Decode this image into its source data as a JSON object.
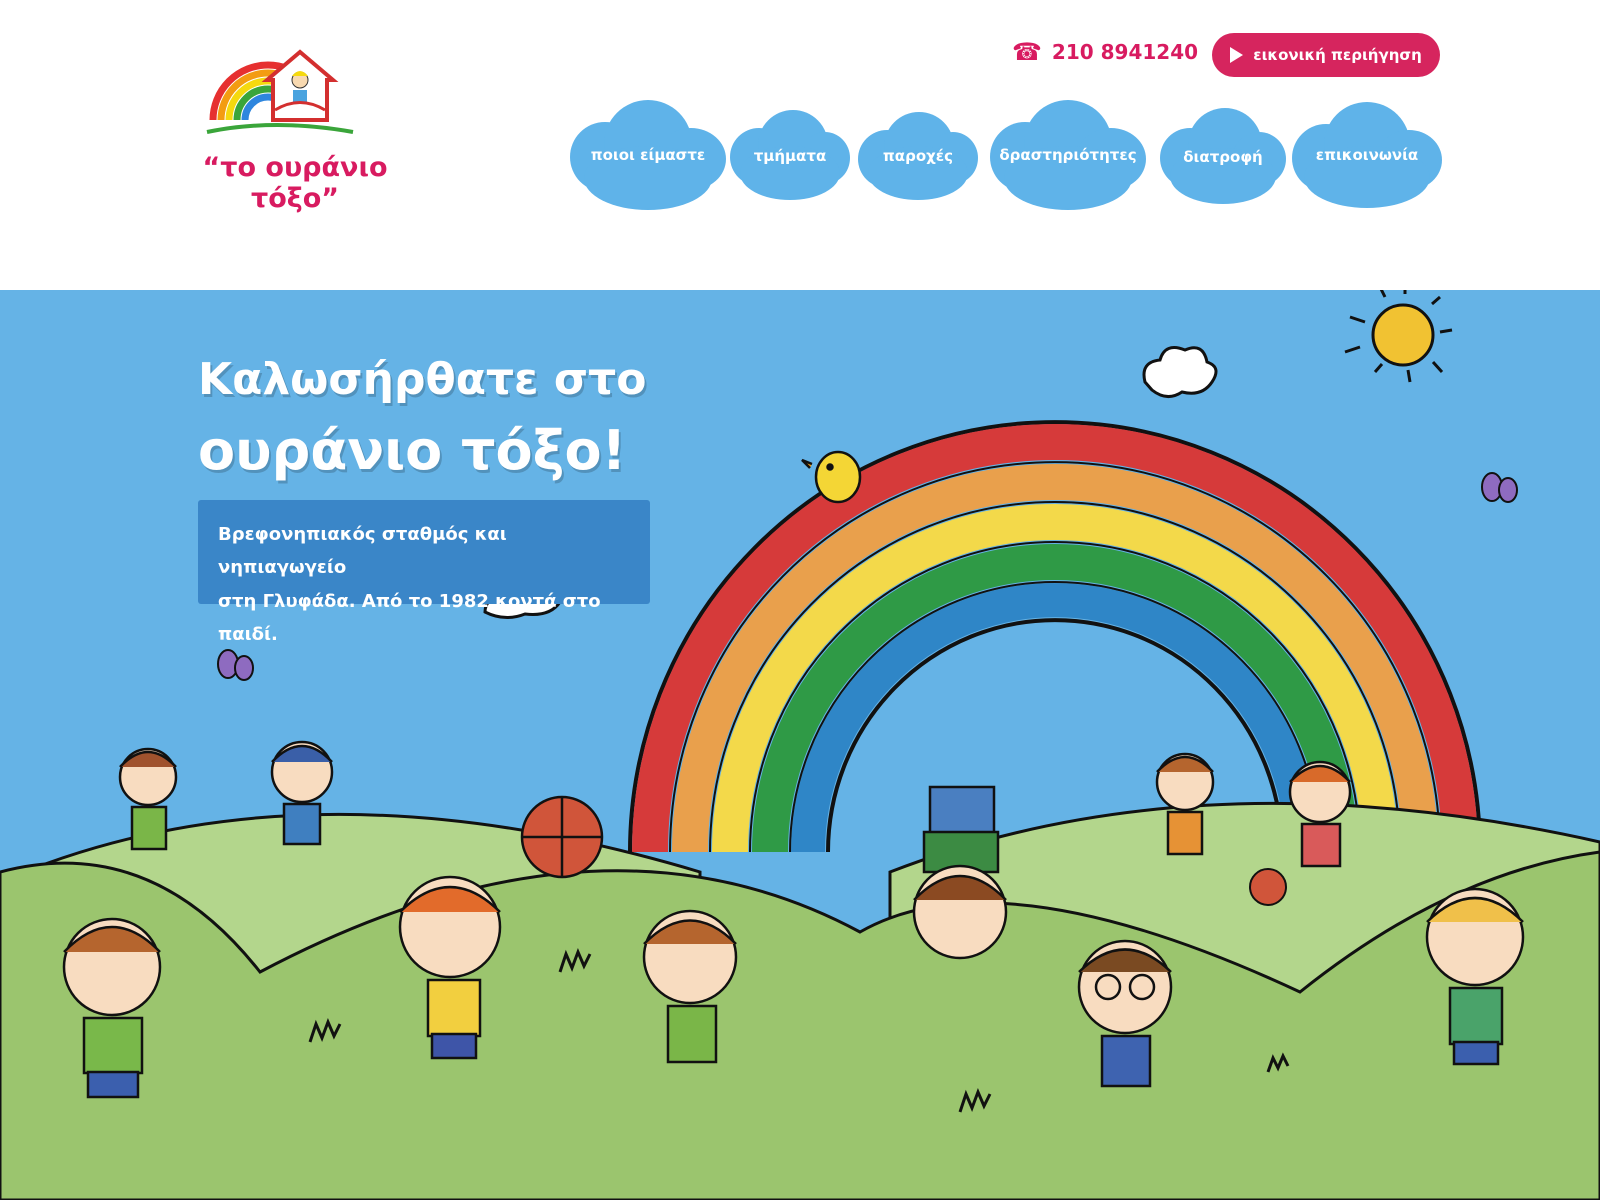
{
  "brand": {
    "name": "“το ουράνιο τόξο”",
    "colors": {
      "accent": "#d6255e",
      "sky": "#65b3e6",
      "nav_cloud": "#5fb3e9",
      "grass": "#9bc56e"
    }
  },
  "contact": {
    "phone_icon": "phone-icon",
    "phone": "210 8941240"
  },
  "cta": {
    "icon": "play-icon",
    "label": "εικονική περιήγηση"
  },
  "nav": {
    "items": [
      {
        "label": "ποιοι είμαστε"
      },
      {
        "label": "τμήματα"
      },
      {
        "label": "παροχές"
      },
      {
        "label": "δραστηριότητες"
      },
      {
        "label": "διατροφή"
      },
      {
        "label": "επικοινωνία"
      }
    ]
  },
  "hero": {
    "title_line1": "Καλωσήρθατε στο",
    "title_line2": "ουράνιο τόξο!",
    "subtitle_line1": "Βρεφονηπιακός σταθμός και νηπιαγωγείο",
    "subtitle_line2": "στη Γλυφάδα. Από το 1982 κοντά στο παιδί.",
    "illustration": "rainbow-hills-children-illustration"
  }
}
